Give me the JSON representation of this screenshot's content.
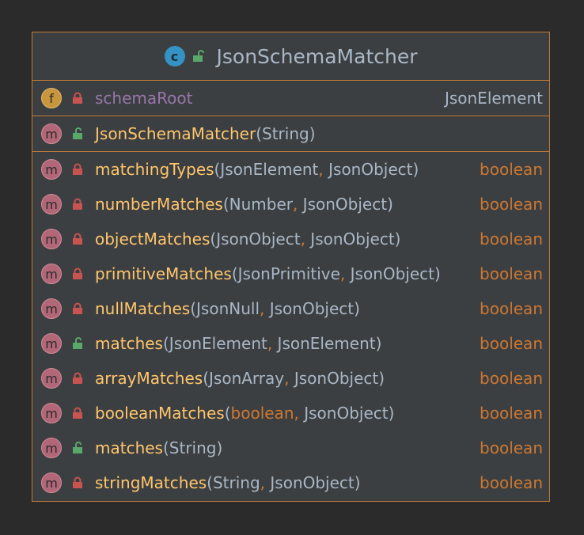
{
  "class": {
    "icon_letter": "c",
    "title": "JsonSchemaMatcher",
    "icon": "class-icon",
    "visibility": "public"
  },
  "field": {
    "icon_letter": "f",
    "name": "schemaRoot",
    "type": "JsonElement",
    "visibility": "private"
  },
  "constructor": {
    "icon_letter": "m",
    "name": "JsonSchemaMatcher",
    "params_text": "(String)",
    "visibility": "public"
  },
  "methods": [
    {
      "icon_letter": "m",
      "visibility": "private",
      "name": "matchingTypes",
      "open": "(",
      "p1": "JsonElement",
      "sep": ",",
      "p2": " JsonObject",
      "close": ")",
      "ret": "boolean"
    },
    {
      "icon_letter": "m",
      "visibility": "private",
      "name": "numberMatches",
      "open": "(",
      "p1": "Number",
      "sep": ",",
      "p2": " JsonObject",
      "close": ")",
      "ret": "boolean"
    },
    {
      "icon_letter": "m",
      "visibility": "private",
      "name": "objectMatches",
      "open": "(",
      "p1": "JsonObject",
      "sep": ",",
      "p2": " JsonObject",
      "close": ")",
      "ret": "boolean"
    },
    {
      "icon_letter": "m",
      "visibility": "private",
      "name": "primitiveMatches",
      "open": "(",
      "p1": "JsonPrimitive",
      "sep": ",",
      "p2": " JsonObject",
      "close": ")",
      "ret": "boolean"
    },
    {
      "icon_letter": "m",
      "visibility": "private",
      "name": "nullMatches",
      "open": "(",
      "p1": "JsonNull",
      "sep": ",",
      "p2": " JsonObject",
      "close": ")",
      "ret": "boolean"
    },
    {
      "icon_letter": "m",
      "visibility": "public",
      "name": "matches",
      "open": "(",
      "p1": "JsonElement",
      "sep": ",",
      "p2": " JsonElement",
      "close": ")",
      "ret": "boolean"
    },
    {
      "icon_letter": "m",
      "visibility": "private",
      "name": "arrayMatches",
      "open": "(",
      "p1": "JsonArray",
      "sep": ",",
      "p2": " JsonObject",
      "close": ")",
      "ret": "boolean"
    },
    {
      "icon_letter": "m",
      "visibility": "private",
      "name": "booleanMatches",
      "open": "(",
      "p1kw": "boolean",
      "sep": ",",
      "p2": " JsonObject",
      "close": ")",
      "ret": "boolean"
    },
    {
      "icon_letter": "m",
      "visibility": "public",
      "name": "matches",
      "open": "(",
      "p1": "String",
      "close": ")",
      "ret": "boolean"
    },
    {
      "icon_letter": "m",
      "visibility": "private",
      "name": "stringMatches",
      "open": "(",
      "p1": "String",
      "sep": ",",
      "p2": " JsonObject",
      "close": ")",
      "ret": "boolean"
    }
  ],
  "colors": {
    "border": "#c27a36",
    "background": "#3c3f41",
    "method_name": "#ffc66d",
    "field_name": "#9876aa",
    "keyword": "#cc7832",
    "text": "#a9b7c6",
    "private_lock": "#c75450",
    "public_lock": "#59a869"
  }
}
